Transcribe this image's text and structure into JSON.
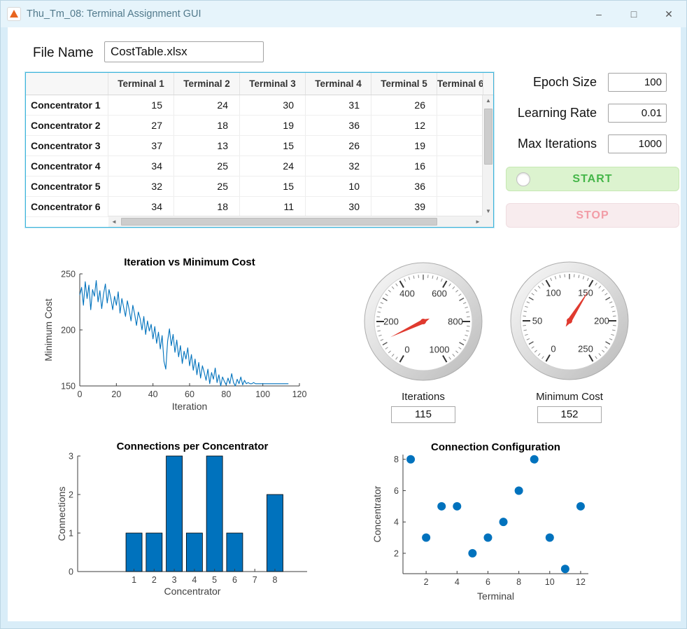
{
  "window": {
    "title": "Thu_Tm_08: Terminal Assignment GUI",
    "controls": {
      "minimize": "–",
      "maximize": "□",
      "close": "✕"
    }
  },
  "icons": {
    "scroll_up": "▲",
    "scroll_down": "▼",
    "scroll_left": "◄",
    "scroll_right": "►"
  },
  "colors": {
    "matlab_blue": "#0072BD",
    "needle_red": "#e03a2f",
    "start_green": "#45b649",
    "stop_pink": "#f29ca6",
    "table_focus_border": "#3db4da",
    "titlebar": "#e6f4fb",
    "frame_blue": "#d9edf8"
  },
  "file": {
    "label": "File Name",
    "value": "CostTable.xlsx"
  },
  "table": {
    "columns": [
      "Terminal 1",
      "Terminal 2",
      "Terminal 3",
      "Terminal 4",
      "Terminal 5",
      "Terminal 6"
    ],
    "rows": [
      {
        "name": "Concentrator 1",
        "values": [
          15,
          24,
          30,
          31,
          26
        ]
      },
      {
        "name": "Concentrator 2",
        "values": [
          27,
          18,
          19,
          36,
          12
        ]
      },
      {
        "name": "Concentrator 3",
        "values": [
          37,
          13,
          15,
          26,
          19
        ]
      },
      {
        "name": "Concentrator 4",
        "values": [
          34,
          25,
          24,
          32,
          16
        ]
      },
      {
        "name": "Concentrator 5",
        "values": [
          32,
          25,
          15,
          10,
          36
        ]
      },
      {
        "name": "Concentrator 6",
        "values": [
          34,
          18,
          11,
          30,
          39
        ]
      }
    ]
  },
  "params": [
    {
      "label": "Epoch Size",
      "value": "100"
    },
    {
      "label": "Learning Rate",
      "value": "0.01"
    },
    {
      "label": "Max Iterations",
      "value": "1000"
    }
  ],
  "buttons": {
    "start": "START",
    "stop": "STOP"
  },
  "gauges": [
    {
      "name": "Iterations",
      "display": "115",
      "value": 115,
      "min": 0,
      "max": 1000,
      "tick_labels": [
        0,
        200,
        400,
        600,
        800,
        1000
      ],
      "label_step": 200,
      "mid_step": 100,
      "minor_step": 20
    },
    {
      "name": "Minimum Cost",
      "display": "152",
      "value": 152,
      "min": 0,
      "max": 250,
      "tick_labels": [
        0,
        50,
        100,
        150,
        200,
        250
      ],
      "label_step": 50,
      "mid_step": 25,
      "minor_step": 5
    }
  ],
  "chart_data": [
    {
      "type": "line",
      "title": "Iteration vs Minimum Cost",
      "xlabel": "Iteration",
      "ylabel": "Minimum Cost",
      "xlim": [
        0,
        120
      ],
      "ylim": [
        150,
        250
      ],
      "xticks": [
        0,
        20,
        40,
        60,
        80,
        100,
        120
      ],
      "yticks": [
        150,
        200,
        250
      ],
      "color": "#0072BD",
      "x_start": 0,
      "values": [
        231,
        238,
        222,
        243,
        228,
        240,
        218,
        236,
        230,
        244,
        225,
        235,
        219,
        232,
        241,
        224,
        236,
        228,
        218,
        230,
        222,
        234,
        215,
        228,
        220,
        212,
        226,
        218,
        208,
        222,
        214,
        204,
        216,
        210,
        200,
        212,
        196,
        208,
        199,
        205,
        192,
        203,
        188,
        198,
        183,
        195,
        172,
        165,
        190,
        201,
        186,
        196,
        180,
        191,
        176,
        186,
        170,
        181,
        174,
        184,
        168,
        178,
        164,
        174,
        160,
        171,
        157,
        168,
        162,
        155,
        165,
        152,
        162,
        156,
        166,
        153,
        160,
        150,
        158,
        154,
        151,
        157,
        152,
        161,
        153,
        150,
        156,
        152,
        158,
        151,
        155,
        152,
        153,
        152,
        152,
        153,
        152,
        152,
        152,
        152,
        152,
        152,
        152,
        152,
        152,
        152,
        152,
        152,
        152,
        152,
        152,
        152,
        152,
        152,
        152
      ]
    },
    {
      "type": "bar",
      "title": "Connections per Concentrator",
      "xlabel": "Concentrator",
      "ylabel": "Connections",
      "categories": [
        1,
        2,
        3,
        4,
        5,
        6,
        7,
        8
      ],
      "values": [
        1,
        1,
        3,
        1,
        3,
        1,
        0,
        2
      ],
      "xlim": [
        -1.8,
        9.6
      ],
      "ylim": [
        0,
        3
      ],
      "yticks": [
        0,
        1,
        2,
        3
      ],
      "bar_width": 0.8,
      "color": "#0072BD"
    },
    {
      "type": "scatter",
      "title": "Connection Configuration",
      "xlabel": "Terminal",
      "ylabel": "Concentrator",
      "x": [
        1,
        2,
        3,
        4,
        5,
        6,
        7,
        8,
        9,
        10,
        11,
        12
      ],
      "y": [
        8,
        3,
        5,
        5,
        2,
        3,
        4,
        6,
        8,
        3,
        1,
        5
      ],
      "xlim": [
        0.5,
        12.5
      ],
      "ylim": [
        0.7,
        8.3
      ],
      "xticks": [
        2,
        4,
        6,
        8,
        10,
        12
      ],
      "yticks": [
        2,
        4,
        6,
        8
      ],
      "marker_radius": 6,
      "color": "#0072BD"
    }
  ]
}
